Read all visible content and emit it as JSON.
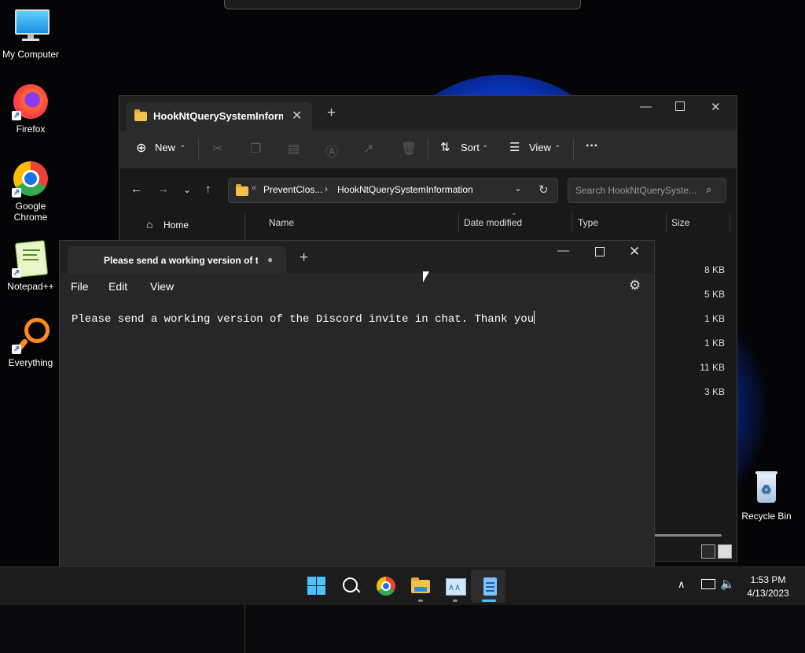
{
  "desktop": {
    "icons": [
      {
        "label": "My Computer"
      },
      {
        "label": "Firefox"
      },
      {
        "label": "Google Chrome"
      },
      {
        "label": "Notepad++"
      },
      {
        "label": "Everything"
      },
      {
        "label": "Recycle Bin"
      }
    ]
  },
  "explorer": {
    "tab_title": "HookNtQuerySystemInformat",
    "toolbar": {
      "new_label": "New",
      "sort_label": "Sort",
      "view_label": "View",
      "more_label": "···"
    },
    "breadcrumb": {
      "parent": "PreventClos...",
      "current": "HookNtQuerySystemInformation"
    },
    "search_placeholder": "Search HookNtQuerySyste...",
    "sidebar": {
      "home_label": "Home"
    },
    "columns": [
      "Name",
      "Date modified",
      "Type",
      "Size"
    ],
    "sizes": [
      "8 KB",
      "5 KB",
      "1 KB",
      "1 KB",
      "11 KB",
      "3 KB"
    ]
  },
  "notepad": {
    "tab_title": "Please send a working version of th",
    "menu": [
      "File",
      "Edit",
      "View"
    ],
    "content": "Please send a working version of the Discord invite in chat. Thank you"
  },
  "taskbar": {
    "time": "1:53 PM",
    "date": "4/13/2023"
  },
  "colors": {
    "accent": "#4cc2ff",
    "folder": "#f2c24c",
    "wallpaper_blue": "#0b3fd6"
  }
}
